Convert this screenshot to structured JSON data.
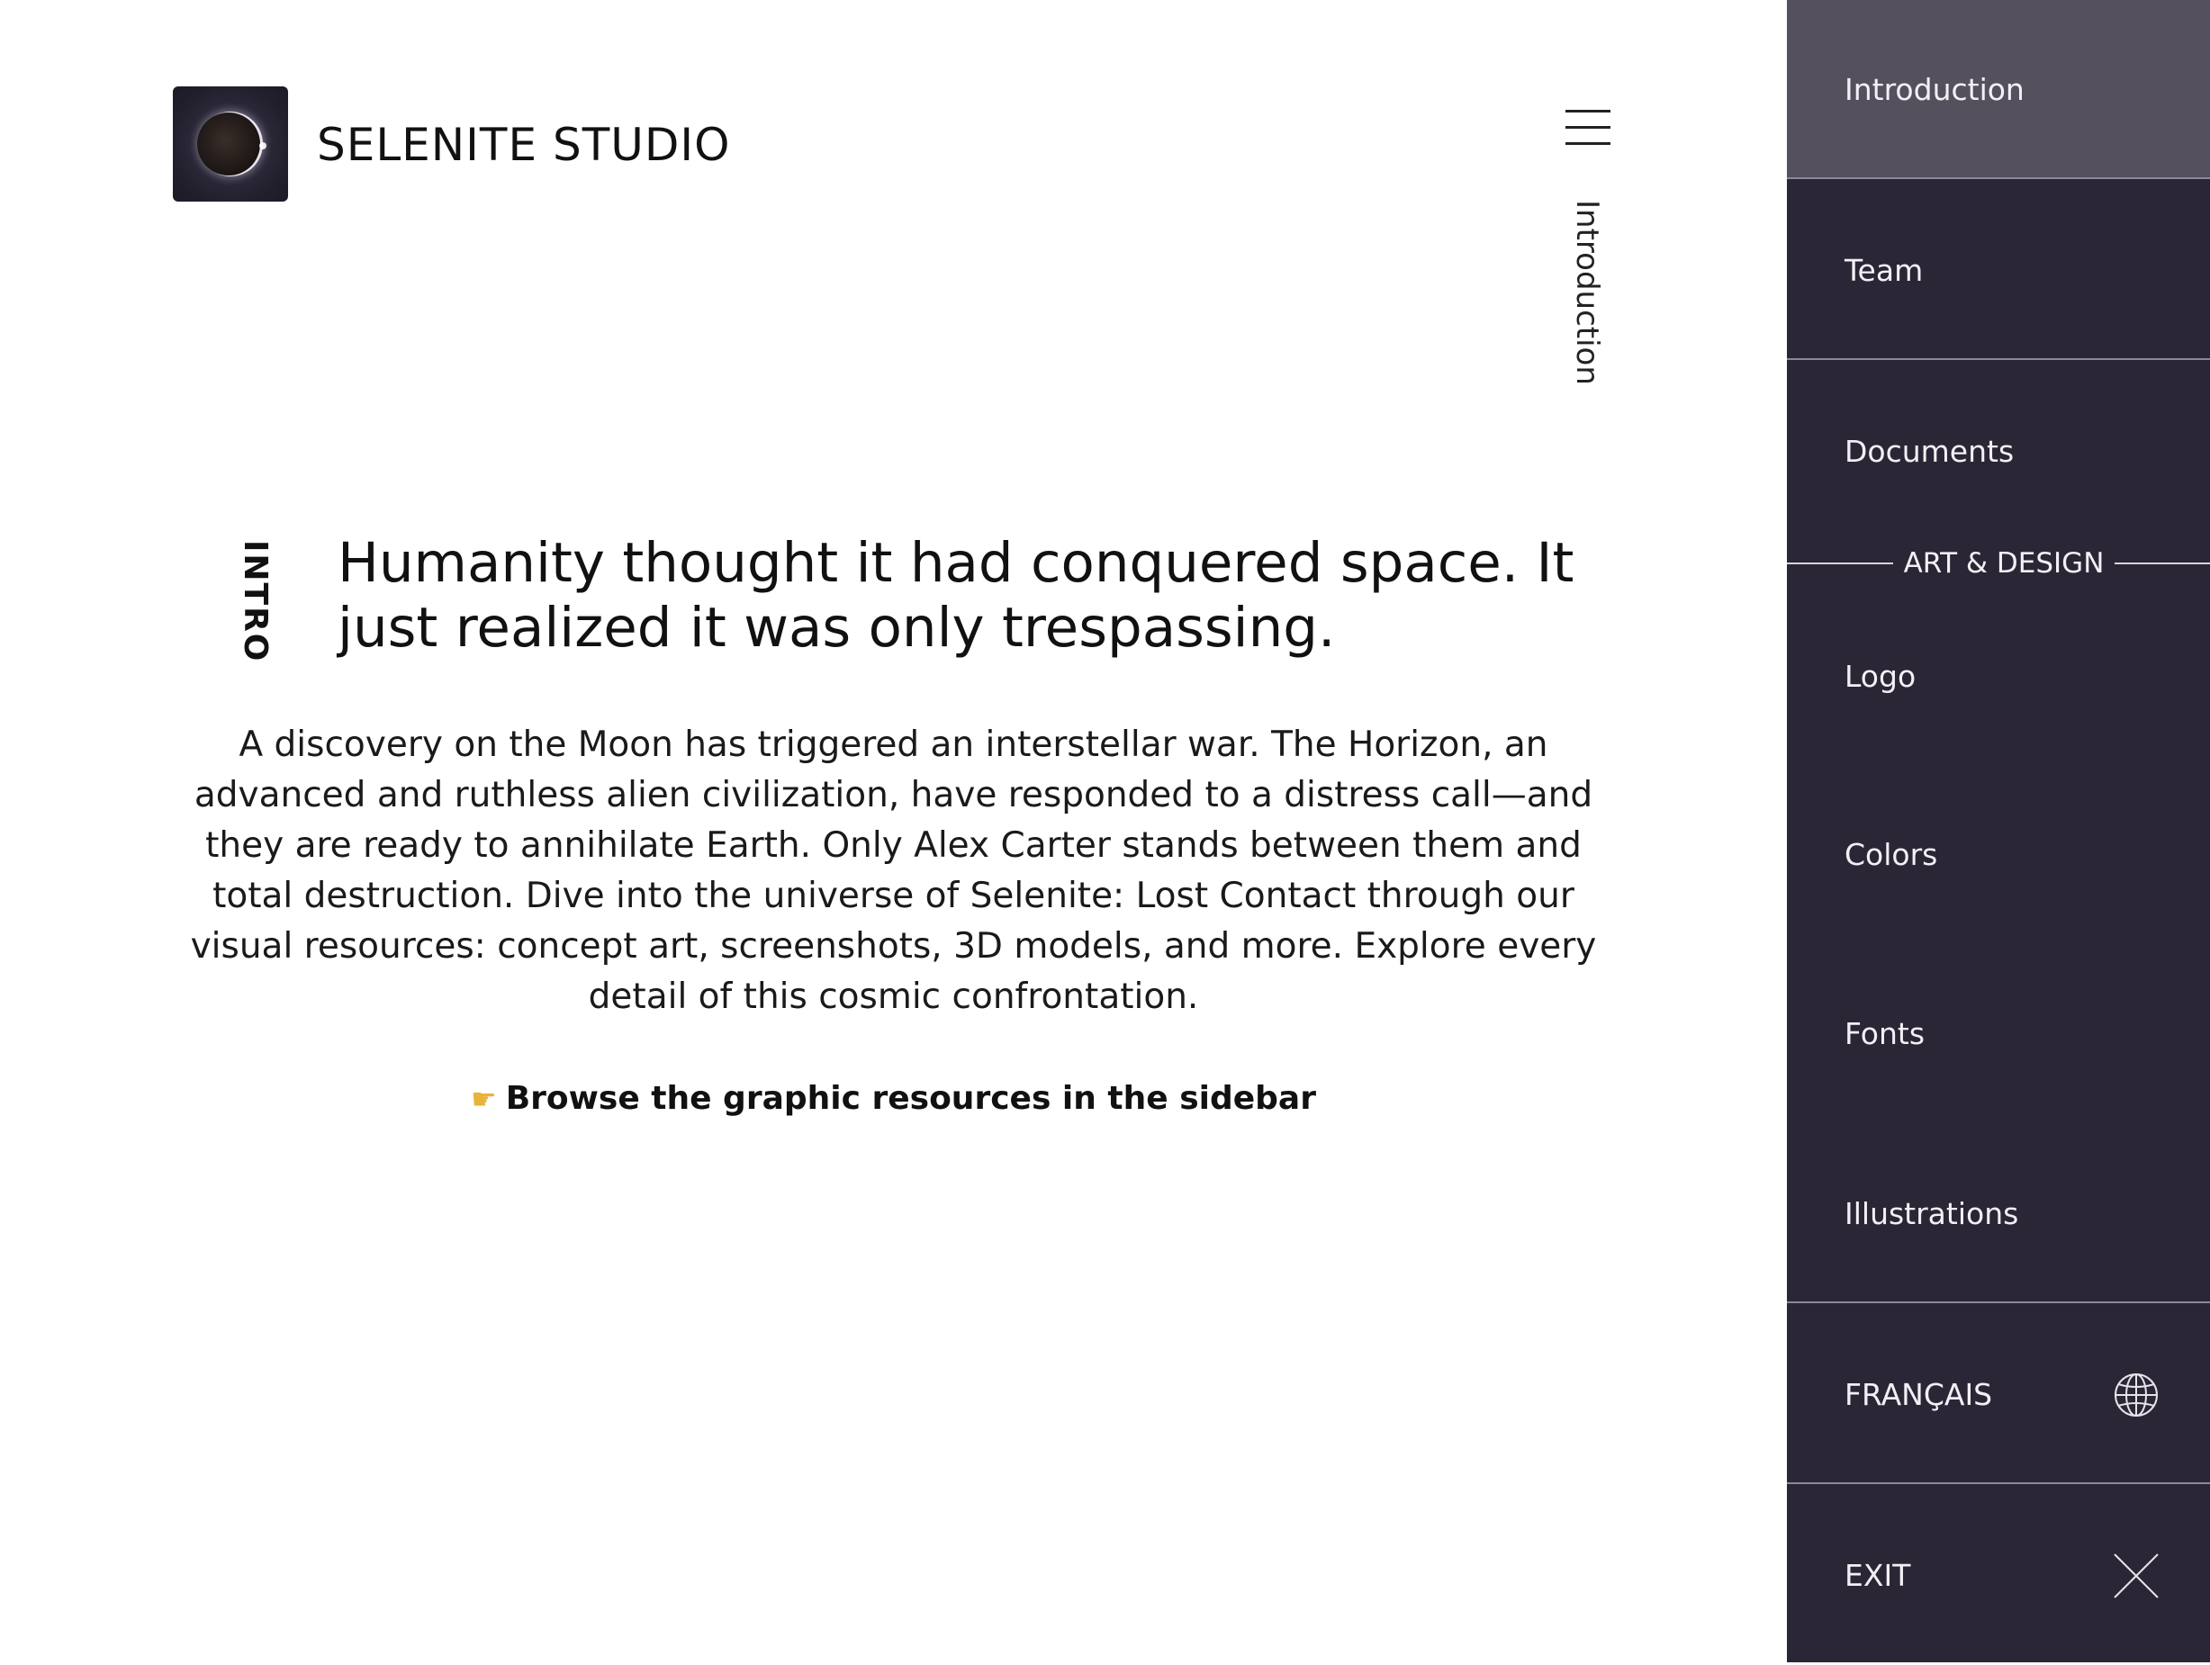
{
  "brand": {
    "name": "SELENITE STUDIO",
    "logo_icon": "eclipse-logo-icon"
  },
  "header": {
    "menu_icon": "hamburger-menu-icon",
    "current_section": "Introduction"
  },
  "intro": {
    "tag": "INTRO",
    "headline": "Humanity thought it had conquered space. It just realized it was only trespassing.",
    "body": "A discovery on the Moon has triggered an interstellar war. The Horizon, an advanced and ruthless alien civilization, have responded to a distress call—and they are ready to annihilate Earth. Only Alex Carter stands between them and total destruction. Dive into the universe of Selenite: Lost Contact through our visual resources: concept art, screenshots, 3D models, and more. Explore every detail of this cosmic confrontation.",
    "cta_icon": "pointing-hand-icon",
    "cta": "Browse the graphic resources in the sidebar"
  },
  "sidebar": {
    "items": [
      {
        "label": "Introduction",
        "active": true
      },
      {
        "label": "Team"
      },
      {
        "label": "Documents"
      },
      {
        "label": "Logo"
      },
      {
        "label": "Colors"
      },
      {
        "label": "Fonts"
      },
      {
        "label": "Illustrations"
      }
    ],
    "section_label": "ART & DESIGN",
    "language": {
      "label": "FRANÇAIS",
      "icon": "globe-icon"
    },
    "exit": {
      "label": "EXIT",
      "icon": "close-icon"
    }
  },
  "colors": {
    "sidebar_bg": "#2b2635",
    "sidebar_active_bg": "#55505e",
    "text_dark": "#111111",
    "text_light": "#f2f0f5"
  }
}
